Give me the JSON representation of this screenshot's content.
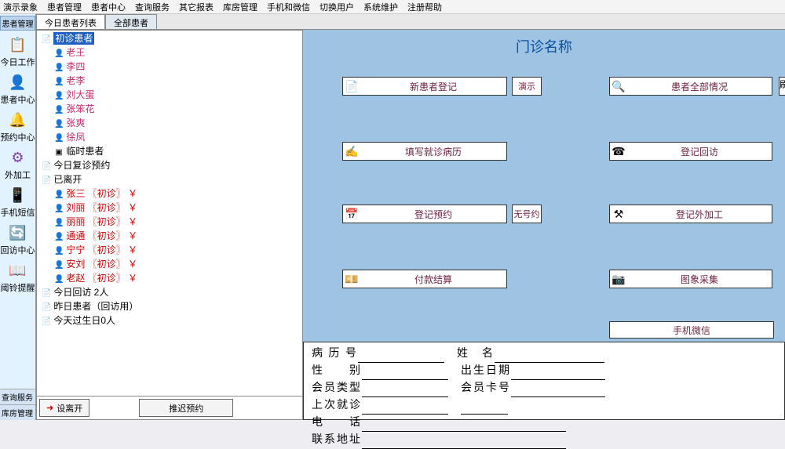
{
  "menu": [
    "演示录象",
    "患者管理",
    "患者中心",
    "查询服务",
    "其它报表",
    "库房管理",
    "手机和微信",
    "切换用户",
    "系统维护",
    "注册帮助"
  ],
  "sidebar": {
    "tab": "患者管理",
    "items": [
      {
        "icon": "📋",
        "color": "#d9534f",
        "label": "今日工作"
      },
      {
        "icon": "👤",
        "color": "#2a6bcc",
        "label": "患者中心"
      },
      {
        "icon": "🔔",
        "color": "#2a9b4f",
        "label": "预约中心"
      },
      {
        "icon": "⚙",
        "color": "#7a3f9f",
        "label": "外加工"
      },
      {
        "icon": "📱",
        "color": "#c93a6a",
        "label": "手机短信"
      },
      {
        "icon": "🔄",
        "color": "#2a9b4f",
        "label": "回访中心"
      },
      {
        "icon": "📖",
        "color": "#2a6bcc",
        "label": "阈铃提醒"
      }
    ],
    "bottom": [
      "查询服务",
      "库房管理"
    ]
  },
  "tabs": [
    {
      "label": "今日患者列表",
      "active": true
    },
    {
      "label": "全部患者",
      "active": false
    }
  ],
  "tree": [
    {
      "lvl": 0,
      "ic": "📄",
      "text": "初诊患者",
      "hl": true
    },
    {
      "lvl": 1,
      "ic": "👤",
      "cls": "pink",
      "text": "老王"
    },
    {
      "lvl": 1,
      "ic": "👤",
      "cls": "pink",
      "text": "李四"
    },
    {
      "lvl": 1,
      "ic": "👤",
      "cls": "pink",
      "text": "老李"
    },
    {
      "lvl": 1,
      "ic": "👤",
      "cls": "pink",
      "text": "刘大蛋"
    },
    {
      "lvl": 1,
      "ic": "👤",
      "cls": "pink",
      "text": "张笨花"
    },
    {
      "lvl": 1,
      "ic": "👤",
      "cls": "pink",
      "text": "张爽"
    },
    {
      "lvl": 1,
      "ic": "👤",
      "cls": "pink",
      "text": "徐凤"
    },
    {
      "lvl": 1,
      "ic": "▣",
      "text": "临时患者"
    },
    {
      "lvl": 0,
      "ic": "📄",
      "text": "今日复诊预约"
    },
    {
      "lvl": 0,
      "ic": "📄",
      "text": "已离开"
    },
    {
      "lvl": 1,
      "ic": "👤",
      "cls": "red",
      "text": "张三 〖初诊〗 ￥"
    },
    {
      "lvl": 1,
      "ic": "👤",
      "cls": "red",
      "text": "刘丽 〖初诊〗 ￥"
    },
    {
      "lvl": 1,
      "ic": "👤",
      "cls": "red",
      "text": "丽丽 〖初诊〗 ￥"
    },
    {
      "lvl": 1,
      "ic": "👤",
      "cls": "red",
      "text": "通通 〖初诊〗 ￥"
    },
    {
      "lvl": 1,
      "ic": "👤",
      "cls": "red",
      "text": "宁宁 〖初诊〗 ￥"
    },
    {
      "lvl": 1,
      "ic": "👤",
      "cls": "red",
      "text": "安刘 〖初诊〗 ￥"
    },
    {
      "lvl": 1,
      "ic": "👤",
      "cls": "red",
      "text": "老赵 〖初诊〗 ￥"
    },
    {
      "lvl": 0,
      "ic": "📄",
      "text": "今日回访  2人"
    },
    {
      "lvl": 0,
      "ic": "📄",
      "text": "昨日患者（回访用）"
    },
    {
      "lvl": 0,
      "ic": "📄",
      "text": "今天过生日0人"
    }
  ],
  "treeFoot": {
    "leave": "设离开",
    "postpone": "推迟预约"
  },
  "right": {
    "title": "门诊名称",
    "row1": {
      "btnL": "新患者登记",
      "small": "演示",
      "btnR": "患者全部情况",
      "cut": "刷"
    },
    "row2": {
      "btnL": "填写就诊病历",
      "btnR": "登记回访"
    },
    "row3": {
      "btnL": "登记预约",
      "small": "无号约",
      "btnR": "登记外加工"
    },
    "row4": {
      "btnL": "付款结算",
      "btnR": "图象采集"
    },
    "phone": "手机微信"
  },
  "form": {
    "l1a": "病 历 号",
    "l1b": "姓　名",
    "l2a": "性　　别",
    "l2b": "出生日期",
    "l3a": "会员类型",
    "l3b": "会员卡号",
    "l4": "上次就诊",
    "l5": "电　　话",
    "l6": "联系地址"
  }
}
